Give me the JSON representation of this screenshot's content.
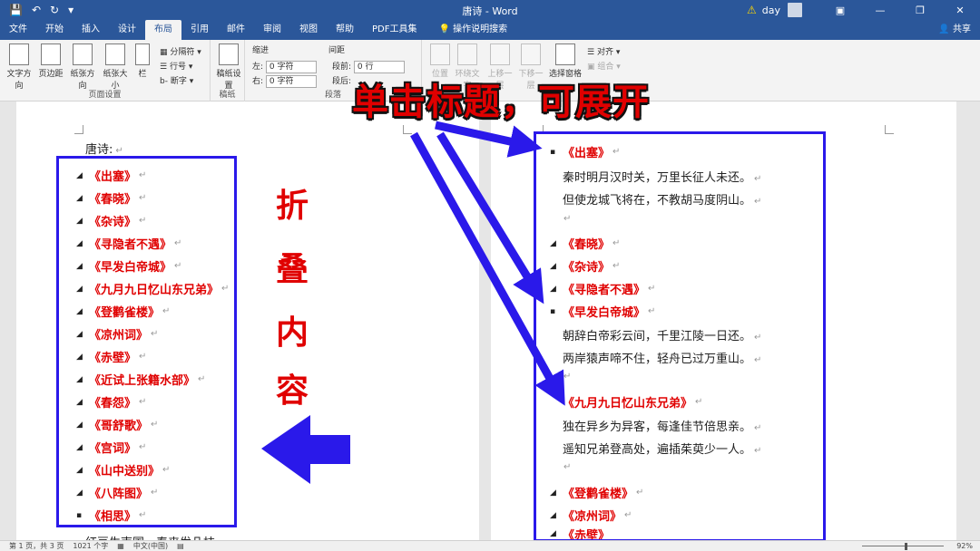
{
  "window": {
    "title": "唐诗 - Word",
    "user": "day",
    "share": "共享"
  },
  "tabs": [
    "文件",
    "开始",
    "插入",
    "设计",
    "布局",
    "引用",
    "邮件",
    "审阅",
    "视图",
    "帮助",
    "PDF工具集"
  ],
  "active_tab": "布局",
  "tell_me": "操作说明搜索",
  "ribbon": {
    "page_setup": {
      "label": "页面设置",
      "text_direction": "文字方向",
      "margins": "页边距",
      "orientation": "纸张方向",
      "size": "纸张大小",
      "columns": "栏",
      "breaks": "分隔符",
      "line_numbers": "行号",
      "hyphenation": "断字"
    },
    "manuscript": {
      "label": "稿纸",
      "button": "稿纸设置"
    },
    "paragraph": {
      "label": "段落",
      "indent": "缩进",
      "spacing": "间距",
      "left": "左:",
      "right": "右:",
      "before": "段前:",
      "after": "段后:",
      "left_val": "0 字符",
      "right_val": "0 字符",
      "before_val": "0 行"
    },
    "arrange": {
      "position": "位置",
      "wrap": "环绕文字",
      "forward": "上移一层",
      "backward": "下移一层",
      "selection": "选择窗格",
      "align": "对齐",
      "group": "组合"
    }
  },
  "left_page": {
    "heading": "唐诗:",
    "items": [
      "《出塞》",
      "《春晓》",
      "《杂诗》",
      "《寻隐者不遇》",
      "《早发白帝城》",
      "《九月九日忆山东兄弟》",
      "《登鹳雀楼》",
      "《凉州词》",
      "《赤壁》",
      "《近试上张籍水部》",
      "《春怨》",
      "《哥舒歌》",
      "《宫词》",
      "《山中送别》",
      "《八阵图》",
      "《相思》"
    ],
    "footer_line": "红豆生南国，春来发几枝"
  },
  "right_page": {
    "t1": "《出塞》",
    "p1a": "秦时明月汉时关，万里长征人未还。",
    "p1b": "但使龙城飞将在，不教胡马度阴山。",
    "t2": "《春晓》",
    "t3": "《杂诗》",
    "t4": "《寻隐者不遇》",
    "t5": "《早发白帝城》",
    "p5a": "朝辞白帝彩云间，千里江陵一日还。",
    "p5b": "两岸猿声啼不住，轻舟已过万重山。",
    "t6": "《九月九日忆山东兄弟》",
    "p6a": "独在异乡为异客，每逢佳节倍思亲。",
    "p6b": "遥知兄弟登高处，遍插茱萸少一人。",
    "t7": "《登鹳雀楼》",
    "t8": "《凉州词》",
    "t9": "《赤壁》"
  },
  "overlay": {
    "click_hint": "单击标题，可展开",
    "fold_chars": [
      "折",
      "叠",
      "内",
      "容"
    ]
  },
  "status": {
    "page": "第 1 页，共 3 页",
    "words": "1021 个字",
    "lang": "中文(中国)",
    "zoom": "92%"
  },
  "colors": {
    "title_bar": "#2b579a",
    "heading_red": "#e00000",
    "annotation_blue": "#2a19ea"
  }
}
